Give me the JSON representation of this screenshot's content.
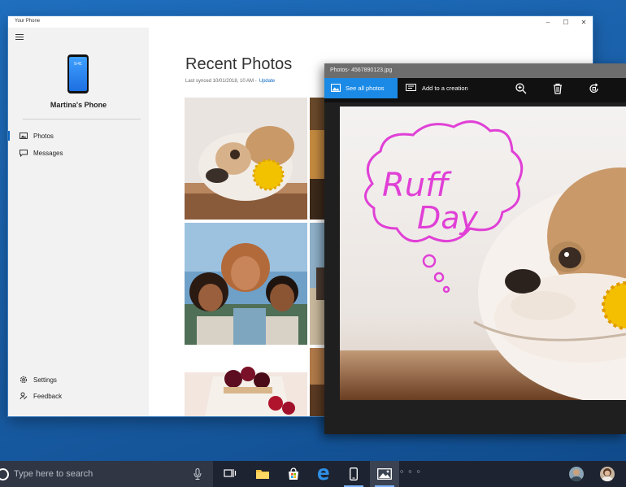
{
  "app": {
    "title": "Your Phone",
    "window_controls": [
      "–",
      "☐",
      "✕"
    ]
  },
  "sidebar": {
    "phone_screen_time": "9:41",
    "phone_name": "Martina's Phone",
    "nav": [
      {
        "label": "Photos",
        "icon": "photos-icon",
        "active": true
      },
      {
        "label": "Messages",
        "icon": "messages-icon",
        "active": false
      }
    ],
    "bottom": [
      {
        "label": "Settings",
        "icon": "gear-icon"
      },
      {
        "label": "Feedback",
        "icon": "feedback-icon"
      }
    ]
  },
  "main": {
    "title": "Recent Photos",
    "sync_text": "Last synced 10/01/2018, 10 AM -",
    "update_link": "Update"
  },
  "viewer": {
    "title": "Photos- 4567890123.jpg",
    "see_all": "See all photos",
    "add_creation": "Add to a creation",
    "ink_text_line1": "Ruff",
    "ink_text_line2": "Day"
  },
  "taskbar": {
    "search_placeholder": "Type here to search"
  },
  "colors": {
    "accent": "#1b8ae6",
    "ink": "#e040d6",
    "desktop": "#1a5fa8"
  }
}
